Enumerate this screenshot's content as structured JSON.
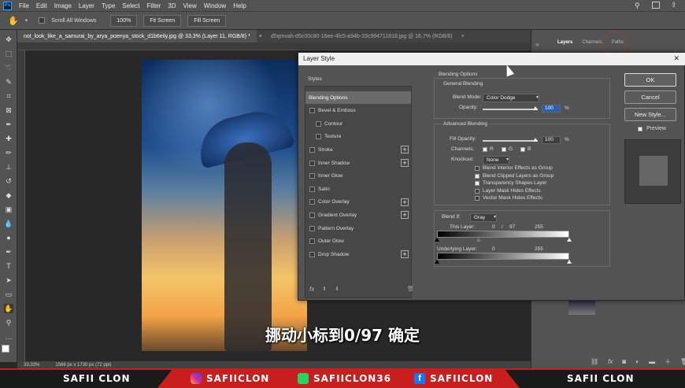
{
  "menubar": {
    "items": [
      "File",
      "Edit",
      "Image",
      "Layer",
      "Type",
      "Select",
      "Filter",
      "3D",
      "View",
      "Window",
      "Help"
    ]
  },
  "optionsbar": {
    "scroll_all_label": "Scroll All Windows",
    "zoom_label": "100%",
    "fit_screen_label": "Fit Screen",
    "fill_screen_label": "Fill Screen"
  },
  "doc_tabs": {
    "active": "not_look_like_a_samurai_by_arya_poenya_stock_d1b6eily.jpg @ 33,3% (Layer 11, RGB/8) *",
    "inactive": "d5qmvah-d5c00c80-16ee-4fc5-a94b-33c994711818.jpg @ 16,7% (RGB/8)"
  },
  "statusbar": {
    "zoom": "33,33%",
    "doc_size": "1566 px x 1730 px (72 ppi)"
  },
  "panel_tabs": {
    "layers": "Layers",
    "channels": "Channels",
    "paths": "Paths"
  },
  "dialog": {
    "title": "Layer Style",
    "styles_header": "Styles",
    "styles": [
      {
        "label": "Blending Options",
        "checkbox": false,
        "plus": false,
        "selected": true,
        "indent": false
      },
      {
        "label": "Bevel & Emboss",
        "checkbox": true,
        "plus": false,
        "selected": false,
        "indent": false
      },
      {
        "label": "Contour",
        "checkbox": true,
        "plus": false,
        "selected": false,
        "indent": true
      },
      {
        "label": "Texture",
        "checkbox": true,
        "plus": false,
        "selected": false,
        "indent": true
      },
      {
        "label": "Stroke",
        "checkbox": true,
        "plus": true,
        "selected": false,
        "indent": false
      },
      {
        "label": "Inner Shadow",
        "checkbox": true,
        "plus": true,
        "selected": false,
        "indent": false
      },
      {
        "label": "Inner Glow",
        "checkbox": true,
        "plus": false,
        "selected": false,
        "indent": false
      },
      {
        "label": "Satin",
        "checkbox": true,
        "plus": false,
        "selected": false,
        "indent": false
      },
      {
        "label": "Color Overlay",
        "checkbox": true,
        "plus": true,
        "selected": false,
        "indent": false
      },
      {
        "label": "Gradient Overlay",
        "checkbox": true,
        "plus": true,
        "selected": false,
        "indent": false
      },
      {
        "label": "Pattern Overlay",
        "checkbox": true,
        "plus": false,
        "selected": false,
        "indent": false
      },
      {
        "label": "Outer Glow",
        "checkbox": true,
        "plus": false,
        "selected": false,
        "indent": false
      },
      {
        "label": "Drop Shadow",
        "checkbox": true,
        "plus": true,
        "selected": false,
        "indent": false
      }
    ],
    "blending_options": {
      "header": "Blending Options",
      "general_header": "General Blending",
      "blend_mode_label": "Blend Mode:",
      "blend_mode_value": "Color Dodge",
      "opacity_label": "Opacity:",
      "opacity_value": "100",
      "opacity_unit": "%",
      "advanced_header": "Advanced Blending",
      "fill_opacity_label": "Fill Opacity:",
      "fill_opacity_value": "100",
      "fill_opacity_unit": "%",
      "channels_label": "Channels:",
      "channel_r": "R",
      "channel_g": "G",
      "channel_b": "B",
      "knockout_label": "Knockout:",
      "knockout_value": "None",
      "checks": [
        {
          "label": "Blend Interior Effects as Group",
          "checked": false
        },
        {
          "label": "Blend Clipped Layers as Group",
          "checked": true
        },
        {
          "label": "Transparency Shapes Layer",
          "checked": true
        },
        {
          "label": "Layer Mask Hides Effects",
          "checked": false
        },
        {
          "label": "Vector Mask Hides Effects",
          "checked": false
        }
      ],
      "blend_if_label": "Blend If:",
      "blend_if_value": "Gray",
      "this_layer_label": "This Layer:",
      "this_layer_low": "0",
      "this_layer_sep": "/",
      "this_layer_mid": "97",
      "this_layer_high": "255",
      "underlying_label": "Underlying Layer:",
      "underlying_low": "0",
      "underlying_high": "255"
    },
    "buttons": {
      "ok": "OK",
      "cancel": "Cancel",
      "new_style": "New Style...",
      "preview": "Preview"
    }
  },
  "subtitle": "挪动小标到0/97 确定",
  "banner": {
    "left": "SAFII CLON",
    "instagram": "SAFIICLON",
    "other": "SAFIICLON36",
    "facebook": "SAFIICLON",
    "right": "SAFII CLON"
  }
}
